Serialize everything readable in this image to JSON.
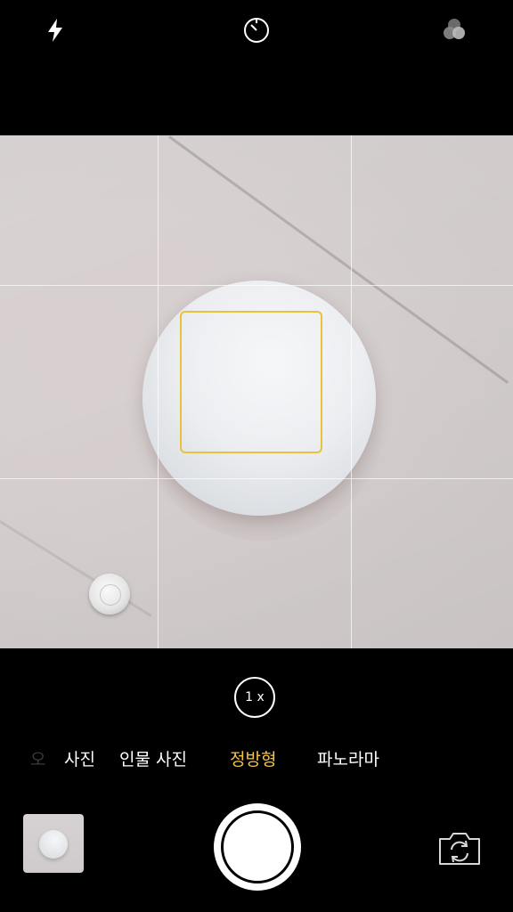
{
  "topbar": {
    "flash_icon": "flash-icon",
    "timer_icon": "timer-icon",
    "filters_icon": "filters-icon"
  },
  "viewfinder": {
    "grid": "3x3",
    "focus_color": "#e8c33a"
  },
  "zoom": {
    "label": "1 x"
  },
  "modes": {
    "items": [
      {
        "label": "오"
      },
      {
        "label": "사진"
      },
      {
        "label": "인물 사진"
      },
      {
        "label": "정방형"
      },
      {
        "label": "파노라마"
      }
    ],
    "active": "정방형",
    "active_color": "#f5c542"
  },
  "controls": {
    "thumbnail": "last-photo-thumbnail",
    "shutter": "shutter-button",
    "switch_camera_icon": "switch-camera-icon"
  }
}
